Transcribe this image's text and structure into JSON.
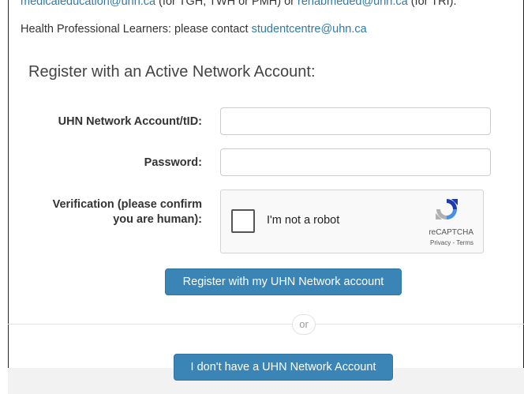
{
  "notice": {
    "line1_link1": "medicaleducation@uhn.ca",
    "line1_text1": " (for TGH, TWH or PMH) or ",
    "line1_link2": "renabmeded@uhn.ca",
    "line1_text2": " (for TRI).",
    "line2_text": "Health Professional Learners: please contact ",
    "line2_link": "studentcentre@uhn.ca"
  },
  "heading": "Register with an Active Network Account:",
  "form": {
    "account_label": "UHN Network Account/tID:",
    "account_value": "",
    "password_label": "Password:",
    "password_value": "",
    "verify_label_line1": "Verification (please confirm",
    "verify_label_line2": "you are human):"
  },
  "captcha": {
    "checkbox_text": "I'm not a robot",
    "brand": "reCAPTCHA",
    "links": "Privacy - Terms"
  },
  "buttons": {
    "register": "Register with my UHN Network account",
    "or": "or",
    "no_account": "I don't have a UHN Network Account"
  },
  "colors": {
    "link": "#2e7aa8",
    "button": "#3b84b6"
  }
}
